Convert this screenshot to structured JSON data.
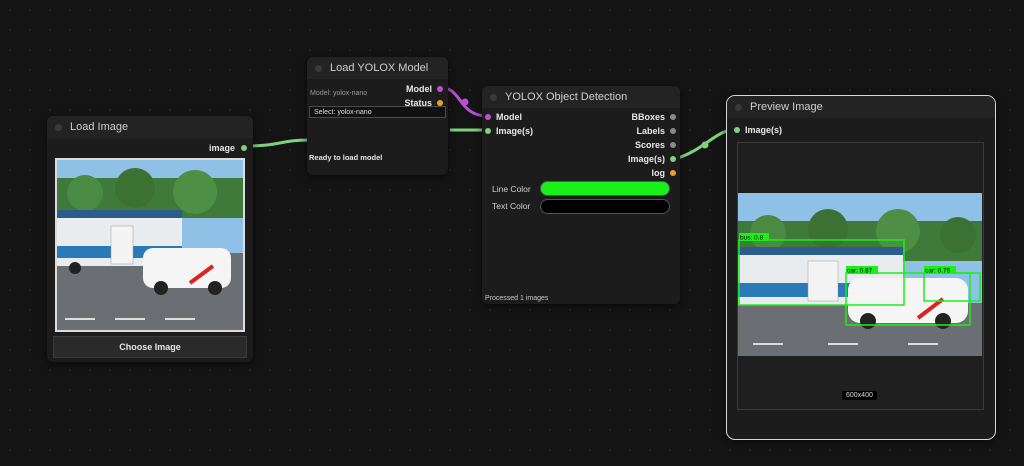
{
  "load_image": {
    "title": "Load Image",
    "output_image": "image",
    "choose_button": "Choose Image"
  },
  "load_yolox": {
    "title": "Load YOLOX Model",
    "model_info": "Model: yolox-nano",
    "select_value": "Select: yolox-nano",
    "status_text": "Ready to load model",
    "out_model": "Model",
    "out_status": "Status"
  },
  "yolox_detect": {
    "title": "YOLOX Object Detection",
    "in_model": "Model",
    "in_images": "Image(s)",
    "out_bboxes": "BBoxes",
    "out_labels": "Labels",
    "out_scores": "Scores",
    "out_images": "Image(s)",
    "out_log": "log",
    "line_color_label": "Line Color",
    "line_color": "#19f019",
    "text_color_label": "Text Color",
    "text_color": "#000000",
    "footer": "Processed 1 images"
  },
  "preview": {
    "title": "Preview Image",
    "in_images": "Image(s)",
    "dimensions": "600x400",
    "detections": [
      {
        "label": "bus: 0.8"
      },
      {
        "label": "car: 0.87"
      },
      {
        "label": "car: 0.76"
      }
    ]
  },
  "colors": {
    "link_green": "#7fd07f",
    "link_purple": "#b84fd4",
    "detection_box": "#19f019"
  }
}
